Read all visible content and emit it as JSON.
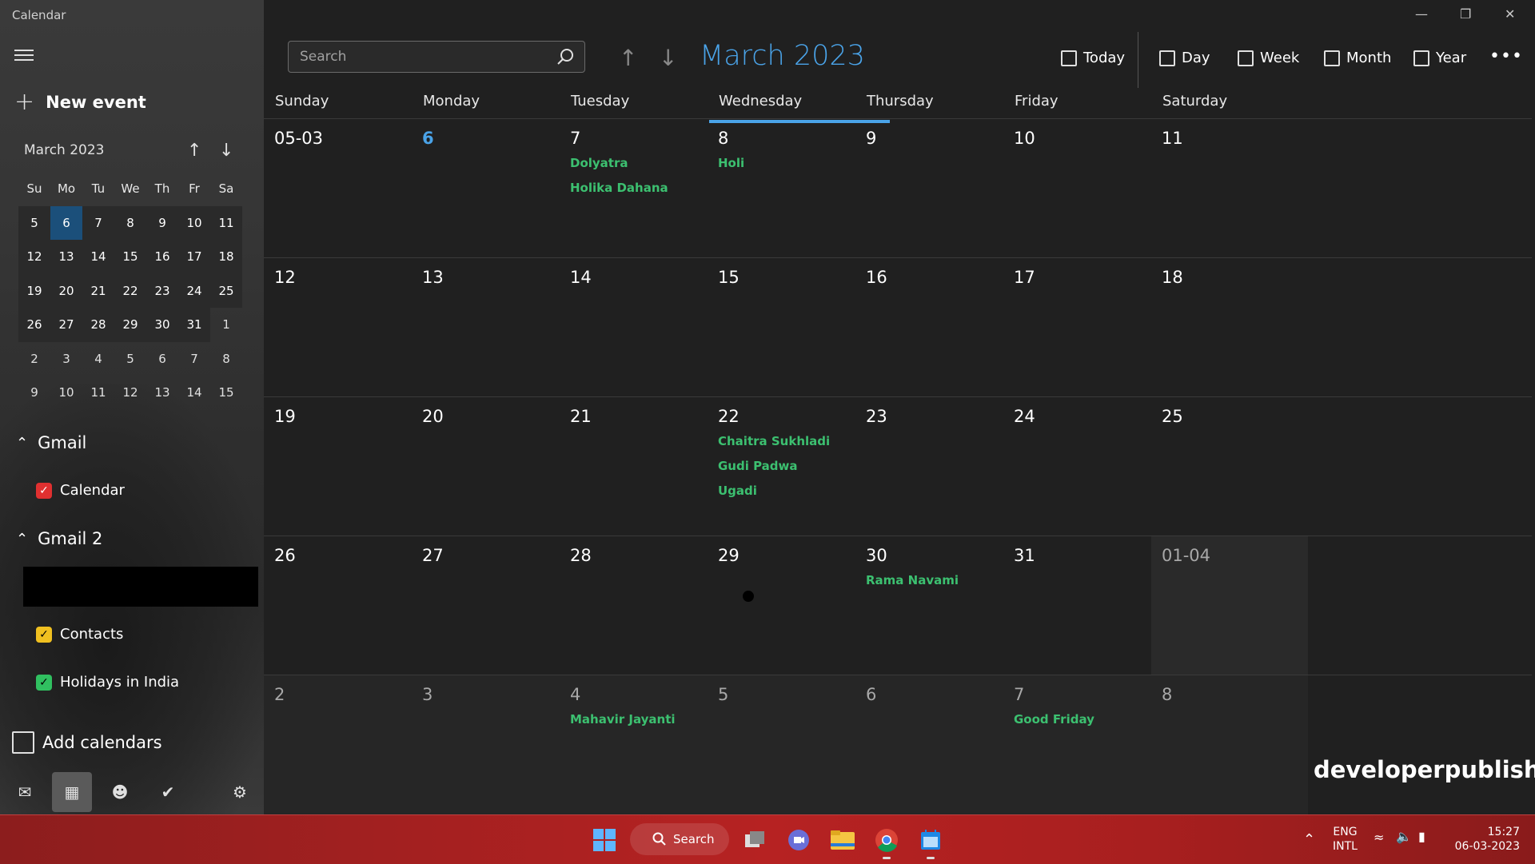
{
  "app": {
    "title": "Calendar"
  },
  "sidebar": {
    "new_event": "New event",
    "mini_calendar": {
      "title": "March 2023",
      "dow": [
        "Su",
        "Mo",
        "Tu",
        "We",
        "Th",
        "Fr",
        "Sa"
      ],
      "rows": [
        [
          "5",
          "6",
          "7",
          "8",
          "9",
          "10",
          "11"
        ],
        [
          "12",
          "13",
          "14",
          "15",
          "16",
          "17",
          "18"
        ],
        [
          "19",
          "20",
          "21",
          "22",
          "23",
          "24",
          "25"
        ],
        [
          "26",
          "27",
          "28",
          "29",
          "30",
          "31",
          "1"
        ],
        [
          "2",
          "3",
          "4",
          "5",
          "6",
          "7",
          "8"
        ],
        [
          "9",
          "10",
          "11",
          "12",
          "13",
          "14",
          "15"
        ]
      ],
      "selected": "6"
    },
    "groups": [
      {
        "label": "Gmail",
        "calendars": [
          {
            "label": "Calendar",
            "color": "#e03030"
          }
        ]
      },
      {
        "label": "Gmail 2",
        "calendars": [
          {
            "label": "Contacts",
            "color": "#f0c020"
          },
          {
            "label": "Holidays in India",
            "color": "#30c060"
          }
        ]
      }
    ],
    "add_calendars": "Add calendars"
  },
  "toolbar": {
    "search_placeholder": "Search",
    "month_title": "March 2023",
    "views": [
      "Today",
      "Day",
      "Week",
      "Month",
      "Year"
    ]
  },
  "month_view": {
    "dow": [
      "Sunday",
      "Monday",
      "Tuesday",
      "Wednesday",
      "Thursday",
      "Friday",
      "Saturday"
    ],
    "weeks": [
      [
        "05-03",
        "6",
        "7",
        "8",
        "9",
        "10",
        "11"
      ],
      [
        "12",
        "13",
        "14",
        "15",
        "16",
        "17",
        "18"
      ],
      [
        "19",
        "20",
        "21",
        "22",
        "23",
        "24",
        "25"
      ],
      [
        "26",
        "27",
        "28",
        "29",
        "30",
        "31",
        "01-04"
      ],
      [
        "2",
        "3",
        "4",
        "5",
        "6",
        "7",
        "8"
      ]
    ],
    "events": {
      "w0d2": [
        "Dolyatra",
        "Holika Dahana"
      ],
      "w0d3": [
        "Holi"
      ],
      "w2d3": [
        "Chaitra Sukhladi",
        "Gudi Padwa",
        "Ugadi"
      ],
      "w3d4": [
        "Rama Navami"
      ],
      "w4d2": [
        "Mahavir Jayanti"
      ],
      "w4d5": [
        "Good Friday"
      ]
    },
    "event_color": "#3cc070",
    "accent_color": "#4aa3e8"
  },
  "watermark": "developerpublish.com",
  "taskbar": {
    "search_label": "Search",
    "lang_top": "ENG",
    "lang_bottom": "INTL",
    "time": "15:27",
    "date": "06-03-2023"
  }
}
